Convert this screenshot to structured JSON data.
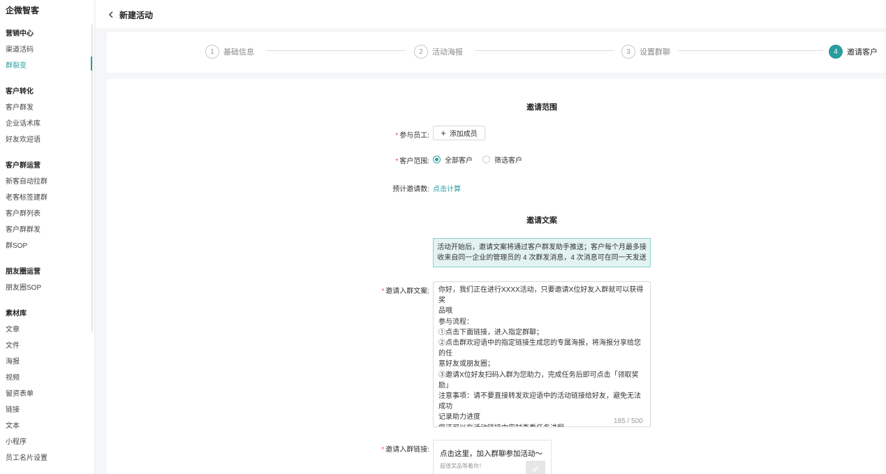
{
  "app": {
    "brand": "企微智客"
  },
  "sidebar": {
    "groups": [
      {
        "title": "营销中心",
        "items": [
          "渠道活码",
          "群裂变"
        ]
      },
      {
        "title": "客户转化",
        "items": [
          "客户群发",
          "企业话术库",
          "好友欢迎语"
        ]
      },
      {
        "title": "客户群运营",
        "items": [
          "新客自动拉群",
          "老客标签建群",
          "客户群列表",
          "客户群群发",
          "群SOP"
        ]
      },
      {
        "title": "朋友圈运营",
        "items": [
          "朋友圈SOP"
        ]
      },
      {
        "title": "素材库",
        "items": [
          "文章",
          "文件",
          "海报",
          "视频",
          "留资表单",
          "链接",
          "文本",
          "小程序",
          "员工名片设置"
        ]
      }
    ],
    "active_item": "群裂变"
  },
  "header": {
    "back_icon": "chevron-left-icon",
    "title": "新建活动"
  },
  "stepper": {
    "steps": [
      {
        "num": "1",
        "label": "基础信息"
      },
      {
        "num": "2",
        "label": "活动海报"
      },
      {
        "num": "3",
        "label": "设置群聊"
      },
      {
        "num": "4",
        "label": "邀请客户"
      }
    ],
    "active_step": 4
  },
  "form": {
    "scope_title": "邀请范围",
    "staff_label": "参与员工:",
    "add_member_label": "添加成员",
    "customer_scope_label": "客户范围:",
    "customer_scope_options": [
      "全部客户",
      "筛选客户"
    ],
    "customer_scope_selected": "全部客户",
    "estimate_label": "预计邀请数:",
    "estimate_link": "点击计算",
    "copy_title": "邀请文案",
    "notice_lines": [
      "活动开始后，邀请文案将通过客户群发助手推送；客户每个月最多接",
      "收来自同一企业的管理员的 4 次群发消息，4 次消息可在同一天发送"
    ],
    "invite_text_label": "邀请入群文案:",
    "invite_text_value": "你好，我们正在进行XXXX活动，只要邀请X位好友入群就可以获得奖\n品哦\n参与流程：\n①点击下面链接，进入指定群聊；\n②点击群欢迎语中的指定链接生成您的专属海报，将海报分享给您的任\n意好友或朋友圈；\n③邀请X位好友扫码入群为您助力，完成任务后即可点击「领取奖励」\n注意事项：请不要直接转发欢迎语中的活动链接给好友，避免无法成功\n记录助力进度\n您还可以在活动链接中实时查看任务进程",
    "invite_text_counter": "185 / 500",
    "invite_link_label": "邀请入群链接:",
    "link_card_title": "点击这里，加入群聊参加活动～",
    "link_card_desc": "超值奖品等着你！",
    "link_card_icon": "link-icon"
  },
  "colors": {
    "accent": "#2a9d9c",
    "required": "#f04e4e",
    "notice_bg": "#e3f3f2"
  }
}
